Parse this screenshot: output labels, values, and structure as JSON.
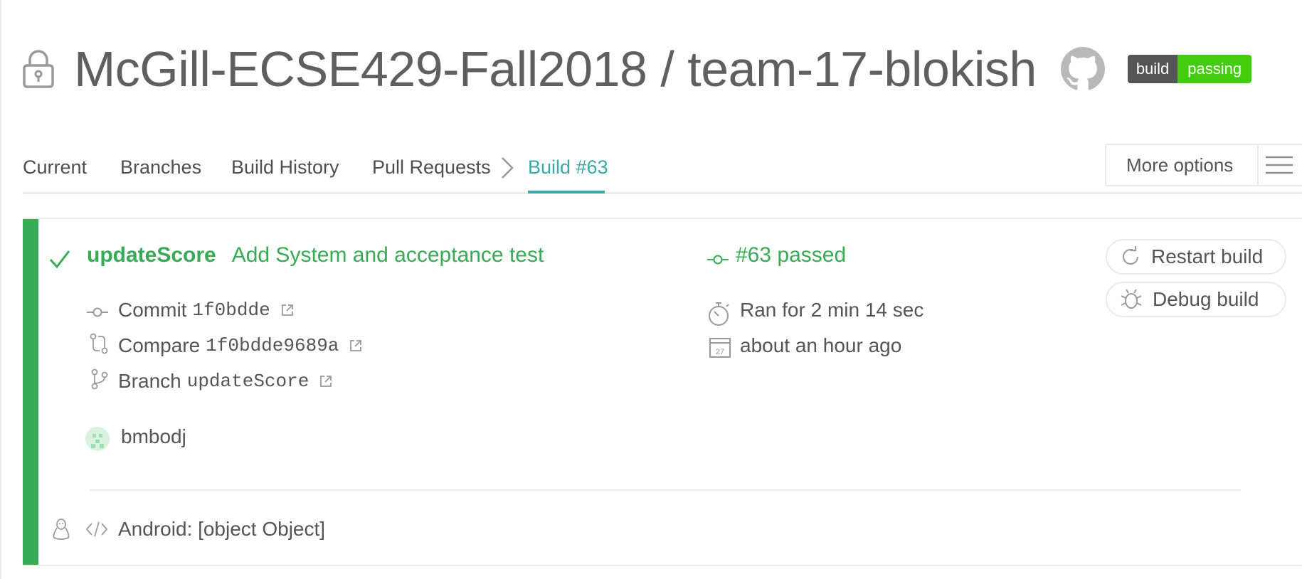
{
  "header": {
    "repo_title": "McGill-ECSE429-Fall2018 / team-17-blokish",
    "badge_left": "build",
    "badge_right": "passing",
    "icons": [
      "lock-icon",
      "github-icon"
    ]
  },
  "nav": {
    "tabs": [
      {
        "label": "Current"
      },
      {
        "label": "Branches"
      },
      {
        "label": "Build History"
      },
      {
        "label": "Pull Requests"
      }
    ],
    "active_tab": "Build #63",
    "more_options": "More options"
  },
  "build": {
    "branch": "updateScore",
    "commit_message": "Add System and acceptance test",
    "status": "#63 passed",
    "commit_label": "Commit",
    "commit_sha": "1f0bdde",
    "compare_label": "Compare",
    "compare_sha": "1f0bdde9689a",
    "branch_label": "Branch",
    "branch_name": "updateScore",
    "author": "bmbodj",
    "duration": "Ran for 2 min 14 sec",
    "finished": "about an hour ago",
    "calendar_day": "27",
    "job_info": "Android: [object Object]"
  },
  "actions": {
    "restart": "Restart build",
    "debug": "Debug build"
  },
  "colors": {
    "passed_green": "#39aa56",
    "active_teal": "#3aa9a9",
    "badge_dark": "#555555",
    "badge_green": "#44cc11"
  }
}
